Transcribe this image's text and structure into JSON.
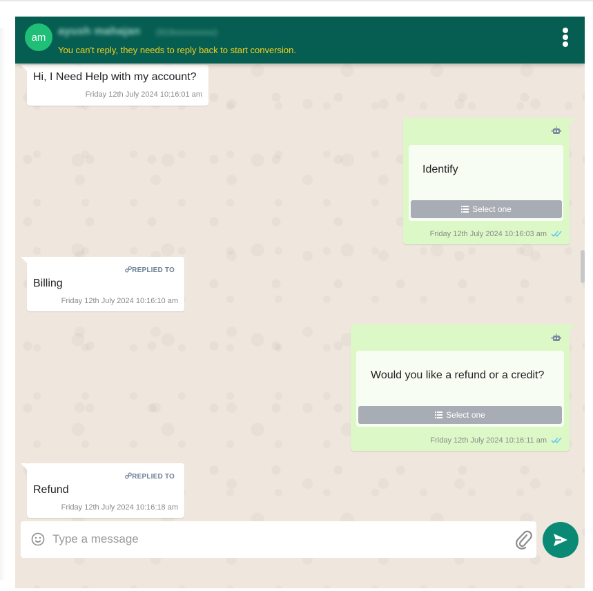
{
  "header": {
    "avatar_initials": "am",
    "contact_name": "ayush mahajan",
    "contact_phone": "(919xxxxxxxxx)",
    "notice": "You can't reply, they needs to reply back to start conversion."
  },
  "messages": [
    {
      "direction": "incoming",
      "text": "Hi, I Need Help with my account?",
      "time": "Friday 12th July 2024 10:16:01 am"
    },
    {
      "direction": "outgoing",
      "card_text": "Identify",
      "button_label": "Select one",
      "time": "Friday 12th July 2024 10:16:03 am"
    },
    {
      "direction": "incoming",
      "replied_label": "REPLIED TO",
      "text": "Billing",
      "time": "Friday 12th July 2024 10:16:10 am"
    },
    {
      "direction": "outgoing",
      "card_text": "Would you like a refund or a credit?",
      "button_label": "Select one",
      "time": "Friday 12th July 2024 10:16:11 am"
    },
    {
      "direction": "incoming",
      "replied_label": "REPLIED TO",
      "text": "Refund",
      "time": "Friday 12th July 2024 10:16:18 am"
    }
  ],
  "composer": {
    "placeholder": "Type a message",
    "value": ""
  },
  "colors": {
    "header": "#065d52",
    "notice": "#f3d21b",
    "outgoing": "#dcf8c6",
    "send": "#0a8a74",
    "ticks": "#4fc3f7"
  },
  "icons": [
    "menu-dots-icon",
    "robot-icon",
    "list-icon",
    "double-check-icon",
    "link-icon",
    "emoji-icon",
    "paperclip-icon",
    "send-icon"
  ]
}
